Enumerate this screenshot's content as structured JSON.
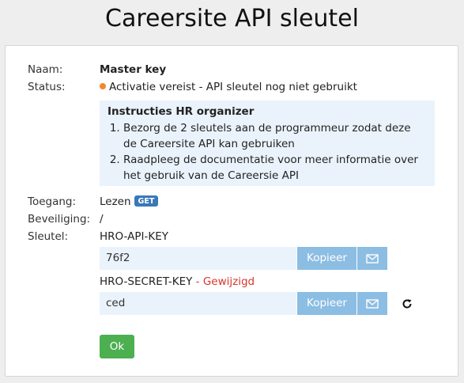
{
  "page": {
    "title": "Careersite API sleutel"
  },
  "labels": {
    "name": "Naam:",
    "status": "Status:",
    "access": "Toegang:",
    "security": "Beveiliging:",
    "key": "Sleutel:"
  },
  "values": {
    "name": "Master key",
    "status": "Activatie vereist - API sleutel nog niet gebruikt",
    "status_color": "#f0892e",
    "access": "Lezen",
    "access_badge": "GET",
    "security": "/"
  },
  "instructions": {
    "title": "Instructies HR organizer",
    "items": [
      "Bezorg de 2 sleutels aan de programmeur zodat deze de Careersite API kan gebruiken",
      "Raadpleeg de documentatie voor meer informatie over het gebruik van de Careersie API"
    ]
  },
  "api_key": {
    "label": "HRO-API-KEY",
    "value": "76f2",
    "copy_label": "Kopieer",
    "mail_icon": "mail-icon"
  },
  "secret_key": {
    "label": "HRO-SECRET-KEY",
    "changed_label": " - Gewijzigd",
    "value": "ced",
    "copy_label": "Kopieer",
    "mail_icon": "mail-icon",
    "refresh_icon": "refresh-icon"
  },
  "ok_label": "Ok"
}
